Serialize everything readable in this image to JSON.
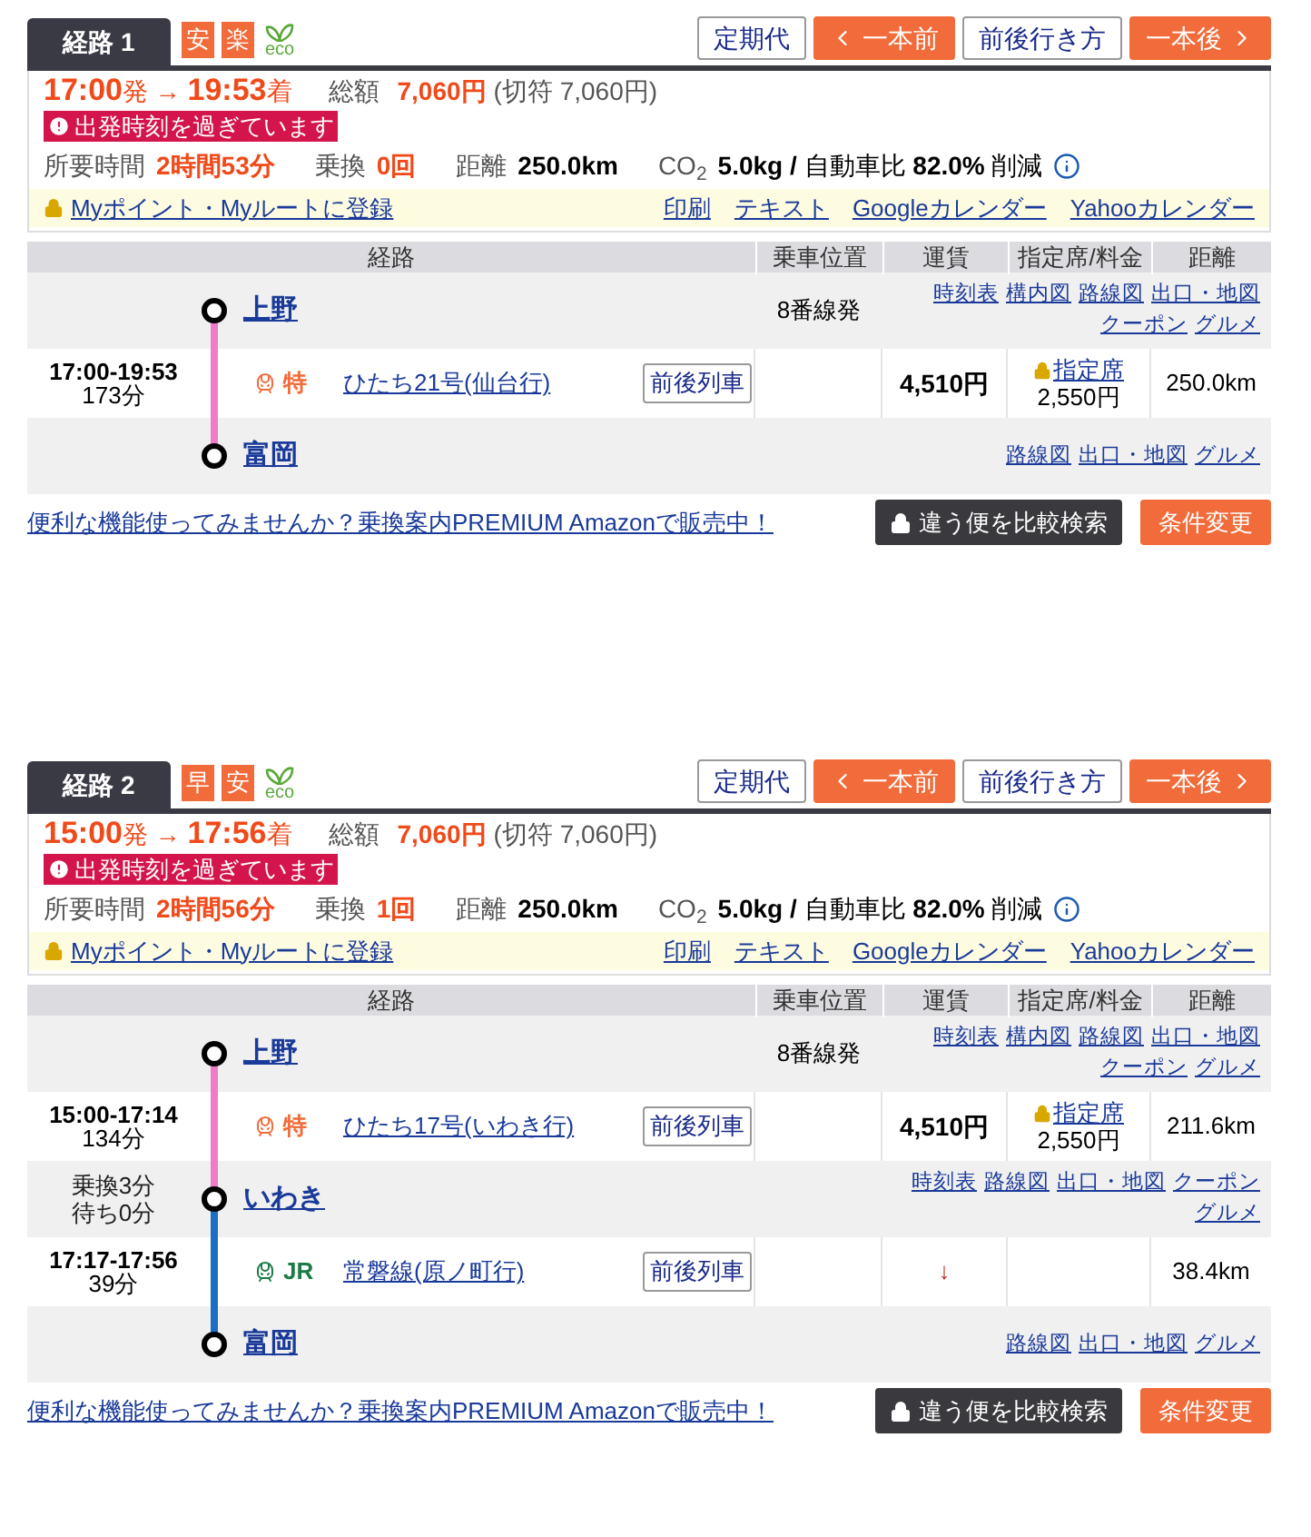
{
  "routes": [
    {
      "tab": "経路 1",
      "badges": [
        {
          "label": "安"
        },
        {
          "label": "楽"
        }
      ],
      "eco_label": "eco",
      "buttons": [
        {
          "label": "定期代",
          "kind": "plain"
        },
        {
          "label": "一本前",
          "kind": "prev"
        },
        {
          "label": "前後行き方",
          "kind": "plain"
        },
        {
          "label": "一本後",
          "kind": "next"
        }
      ],
      "dep_time": "17:00",
      "dep_suffix": "発",
      "arrow": "→",
      "arr_time": "19:53",
      "arr_suffix": "着",
      "total_label": "総額",
      "total": "7,060円",
      "ticket": "(切符 7,060円)",
      "warning": "出発時刻を過ぎています",
      "duration_label": "所要時間",
      "duration": "2時間53分",
      "transfer_label": "乗換",
      "transfers": "0回",
      "distance_label": "距離",
      "distance": "250.0km",
      "co2_label": "CO$_{2}$",
      "co2_value": "**5.0kg /** 自動車比 **82.0%** 削減",
      "register_link": "Myポイント・Myルートに登録",
      "links": [
        "印刷",
        "テキスト",
        "Googleカレンダー",
        "Yahooカレンダー"
      ],
      "columns": [
        "経路",
        "乗車位置",
        "運賃",
        "指定席/料金",
        "距離"
      ],
      "rows": [
        {
          "kind": "station",
          "name": "上野",
          "platform": "8番線発",
          "links": [
            "時刻表",
            "構内図",
            "路線図",
            "出口・地図",
            "クーポン",
            "グルメ"
          ]
        },
        {
          "kind": "segment",
          "color": "#f07cc8",
          "time": "17:00-19:53",
          "minutes": "173分",
          "service": {
            "label": "特",
            "color": "#f26b3a"
          },
          "train": "ひたち21号(仙台行)",
          "button": "前後列車",
          "fare": "4,510円",
          "seat": "指定席",
          "seat_fare": "2,550円",
          "distance": "250.0km"
        },
        {
          "kind": "station",
          "name": "富岡",
          "links": [
            "路線図",
            "出口・地図",
            "グルメ"
          ]
        }
      ],
      "promo": "便利な機能使ってみませんか？乗換案内PREMIUM Amazonで販売中！",
      "compare_button": "違う便を比較検索",
      "change_button": "条件変更"
    },
    {
      "tab": "経路 2",
      "badges": [
        {
          "label": "早"
        },
        {
          "label": "安"
        }
      ],
      "eco_label": "eco",
      "buttons": [
        {
          "label": "定期代",
          "kind": "plain"
        },
        {
          "label": "一本前",
          "kind": "prev"
        },
        {
          "label": "前後行き方",
          "kind": "plain"
        },
        {
          "label": "一本後",
          "kind": "next"
        }
      ],
      "dep_time": "15:00",
      "dep_suffix": "発",
      "arrow": "→",
      "arr_time": "17:56",
      "arr_suffix": "着",
      "total_label": "総額",
      "total": "7,060円",
      "ticket": "(切符 7,060円)",
      "warning": "出発時刻を過ぎています",
      "duration_label": "所要時間",
      "duration": "2時間56分",
      "transfer_label": "乗換",
      "transfers": "1回",
      "distance_label": "距離",
      "distance": "250.0km",
      "co2_label": "CO$_{2}$",
      "co2_value": "**5.0kg /** 自動車比 **82.0%** 削減",
      "register_link": "Myポイント・Myルートに登録",
      "links": [
        "印刷",
        "テキスト",
        "Googleカレンダー",
        "Yahooカレンダー"
      ],
      "columns": [
        "経路",
        "乗車位置",
        "運賃",
        "指定席/料金",
        "距離"
      ],
      "rows": [
        {
          "kind": "station",
          "name": "上野",
          "platform": "8番線発",
          "links": [
            "時刻表",
            "構内図",
            "路線図",
            "出口・地図",
            "クーポン",
            "グルメ"
          ]
        },
        {
          "kind": "segment",
          "color": "#f07cc8",
          "time": "15:00-17:14",
          "minutes": "134分",
          "service": {
            "label": "特",
            "color": "#f26b3a"
          },
          "train": "ひたち17号(いわき行)",
          "button": "前後列車",
          "fare": "4,510円",
          "seat": "指定席",
          "seat_fare": "2,550円",
          "distance": "211.6km"
        },
        {
          "kind": "station",
          "name": "いわき",
          "notes": [
            "乗換3分",
            "待ち0分"
          ],
          "links": [
            "時刻表",
            "路線図",
            "出口・地図",
            "クーポン",
            "グルメ"
          ]
        },
        {
          "kind": "segment",
          "color": "#1a6fc4",
          "time": "17:17-17:56",
          "minutes": "39分",
          "service": {
            "label": "JR",
            "color": "#1b7a45"
          },
          "train": "常磐線(原ノ町行)",
          "button": "前後列車",
          "fare": "↓",
          "distance": "38.4km"
        },
        {
          "kind": "station",
          "name": "富岡",
          "links": [
            "路線図",
            "出口・地図",
            "グルメ"
          ]
        }
      ],
      "promo": "便利な機能使ってみませんか？乗換案内PREMIUM Amazonで販売中！",
      "compare_button": "違う便を比較検索",
      "change_button": "条件変更"
    }
  ]
}
